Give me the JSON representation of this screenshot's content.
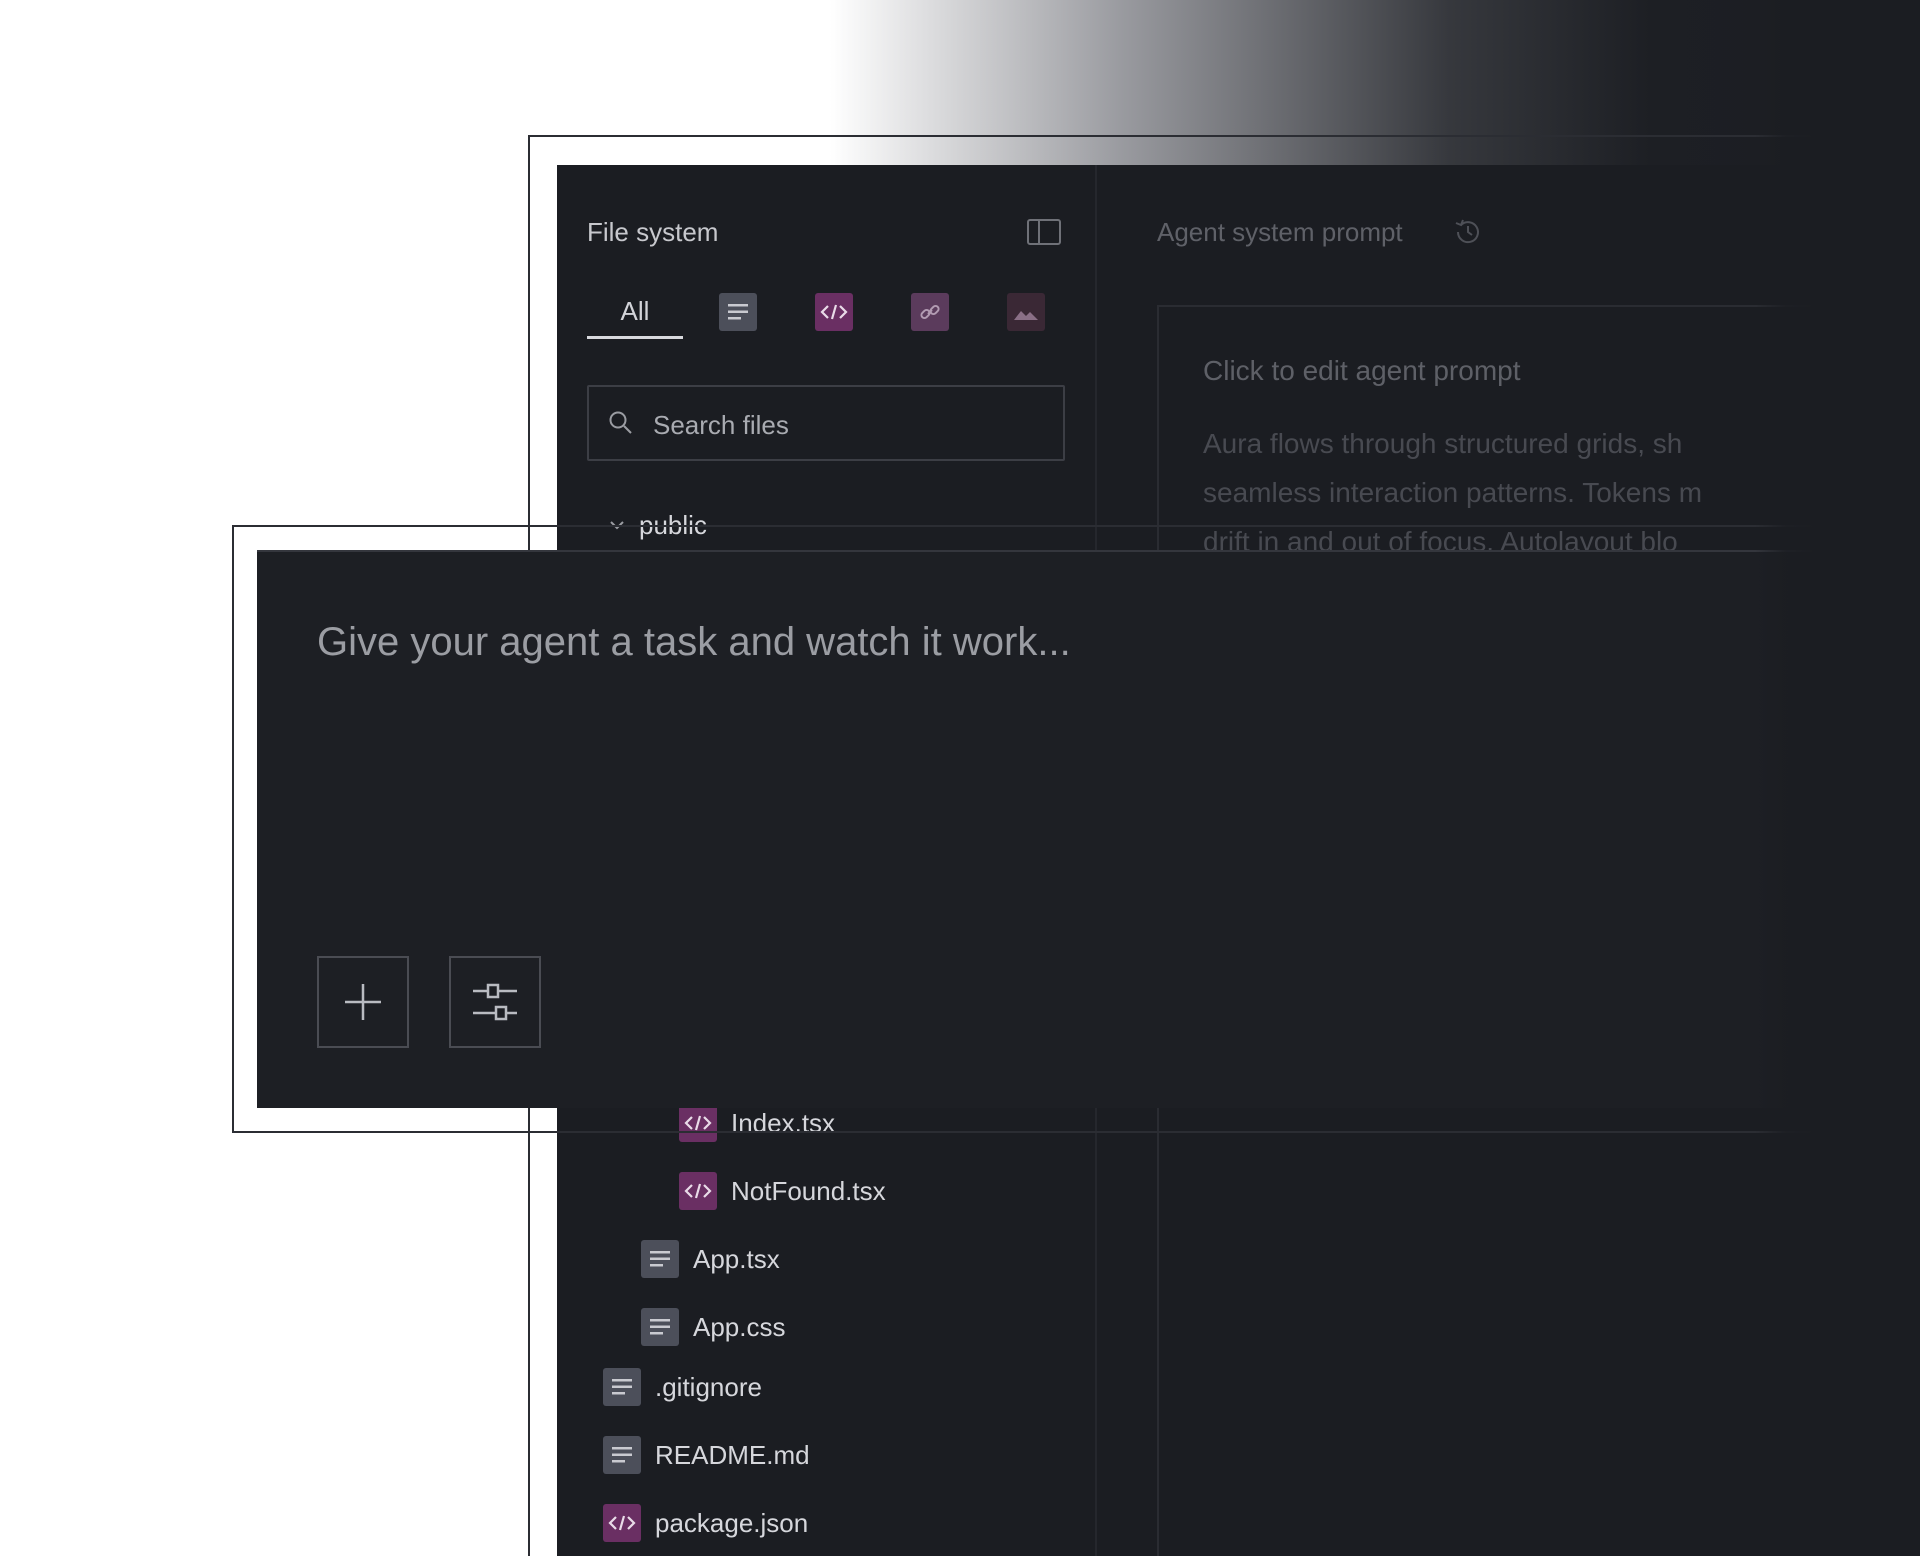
{
  "sidebar": {
    "title": "File system",
    "tabs": {
      "all_label": "All"
    },
    "search": {
      "placeholder": "Search files"
    },
    "tree": {
      "folder_public": "public",
      "file_index": "Index.tsx",
      "file_notfound": "NotFound.tsx",
      "file_app_tsx": "App.tsx",
      "file_app_css": "App.css",
      "file_gitignore": ".gitignore",
      "file_readme": "README.md",
      "file_package": "package.json"
    }
  },
  "main": {
    "title": "Agent system prompt",
    "prompt": {
      "title": "Click to edit agent prompt",
      "line1": "Aura flows through structured grids, sh",
      "line2": "seamless interaction patterns. Tokens m",
      "line3": "drift in and out of focus. Autolayout blo"
    }
  },
  "chat": {
    "placeholder": "Give your agent a task and watch it work..."
  },
  "colors": {
    "background": "#1b1d22",
    "code_icon": "#6a2f63",
    "doc_icon": "#4c4f5a"
  },
  "icons": {
    "panel_toggle": "sidebar-toggle-icon",
    "doc": "doc-icon",
    "code": "code-icon",
    "link": "link-icon",
    "image": "image-icon",
    "search": "search-icon",
    "history": "history-icon",
    "add": "plus-icon",
    "settings": "sliders-icon"
  }
}
